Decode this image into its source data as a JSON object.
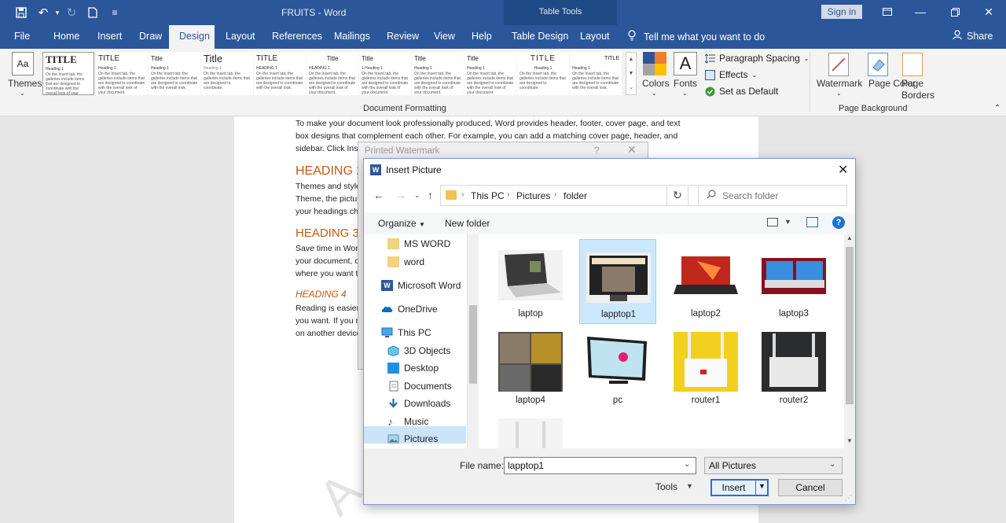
{
  "window": {
    "title": "FRUITS  -  Word",
    "table_tools": "Table Tools",
    "sign_in": "Sign in"
  },
  "tabs": {
    "file": "File",
    "home": "Home",
    "insert": "Insert",
    "draw": "Draw",
    "design": "Design",
    "layout": "Layout",
    "references": "References",
    "mailings": "Mailings",
    "review": "Review",
    "view": "View",
    "help": "Help",
    "table_design": "Table Design",
    "table_layout": "Layout",
    "tell_me": "Tell me what you want to do",
    "share": "Share"
  },
  "ribbon": {
    "themes": "Themes",
    "colors": "Colors",
    "fonts": "Fonts",
    "paragraph_spacing": "Paragraph Spacing",
    "effects": "Effects",
    "set_as_default": "Set as Default",
    "document_formatting": "Document Formatting",
    "watermark": "Watermark",
    "page_color": "Page Color",
    "page_borders": "Page Borders",
    "page_background": "Page Background",
    "gallery": [
      {
        "title": "TITLE",
        "heading": "Heading 1"
      },
      {
        "title": "TITLE",
        "heading": "Heading 1"
      },
      {
        "title": "Title",
        "heading": "Heading 1"
      },
      {
        "title": "Title",
        "heading": "Heading 1"
      },
      {
        "title": "TITLE",
        "heading": "HEADING 1"
      },
      {
        "title": "Title",
        "heading": "HEADING 1"
      },
      {
        "title": "Title",
        "heading": "1  Heading 1"
      },
      {
        "title": "Title",
        "heading": "Heading 1"
      },
      {
        "title": "Title",
        "heading": "Heading 1"
      },
      {
        "title": "TITLE",
        "heading": "Heading 1"
      },
      {
        "title": "TITLE",
        "heading": "Heading 1"
      }
    ]
  },
  "document": {
    "p1_line1": "To make your document look professionally produced, Word provides header, footer, cover page, and text",
    "p1_line2": "box designs that complement each other. For example, you can add a matching cover page, header, and",
    "p1_line3": "sidebar. Click Inse",
    "h2": "HEADING 2",
    "p2_line1": "Themes and style",
    "p2_line2": "Theme, the pictur",
    "p2_line3": "your headings ch",
    "h3": "HEADING 3",
    "p3_line1": "Save time in Word",
    "p3_line2": "your document, cl",
    "p3_line3": "where you want t",
    "h4": "HEADING 4",
    "p4_line1": "Reading is easier,",
    "p4_line2": "you want. If you n",
    "p4_line3": "on another device"
  },
  "printed_watermark": {
    "title": "Printed Watermark",
    "help": "?",
    "close": "✕"
  },
  "insert_picture": {
    "title": "Insert Picture",
    "breadcrumb": [
      "This PC",
      "Pictures",
      "folder"
    ],
    "search_placeholder": "Search folder",
    "organize": "Organize",
    "new_folder": "New folder",
    "nav_items": [
      "MS WORD",
      "word",
      "Microsoft Word",
      "OneDrive",
      "This PC",
      "3D Objects",
      "Desktop",
      "Documents",
      "Downloads",
      "Music",
      "Pictures"
    ],
    "files": [
      {
        "name": "laptop",
        "selected": false
      },
      {
        "name": "lapptop1",
        "selected": true
      },
      {
        "name": "laptop2",
        "selected": false
      },
      {
        "name": "laptop3",
        "selected": false
      },
      {
        "name": "laptop4",
        "selected": false
      },
      {
        "name": "pc",
        "selected": false
      },
      {
        "name": "router1",
        "selected": false
      },
      {
        "name": "router2",
        "selected": false
      }
    ],
    "file_name_label": "File name:",
    "file_name_value": "lapptop1",
    "file_type": "All Pictures",
    "tools": "Tools",
    "insert": "Insert",
    "cancel": "Cancel"
  },
  "colors": {
    "word_blue": "#2b579a",
    "selection": "#cce8ff",
    "heading": "#c55a11"
  }
}
